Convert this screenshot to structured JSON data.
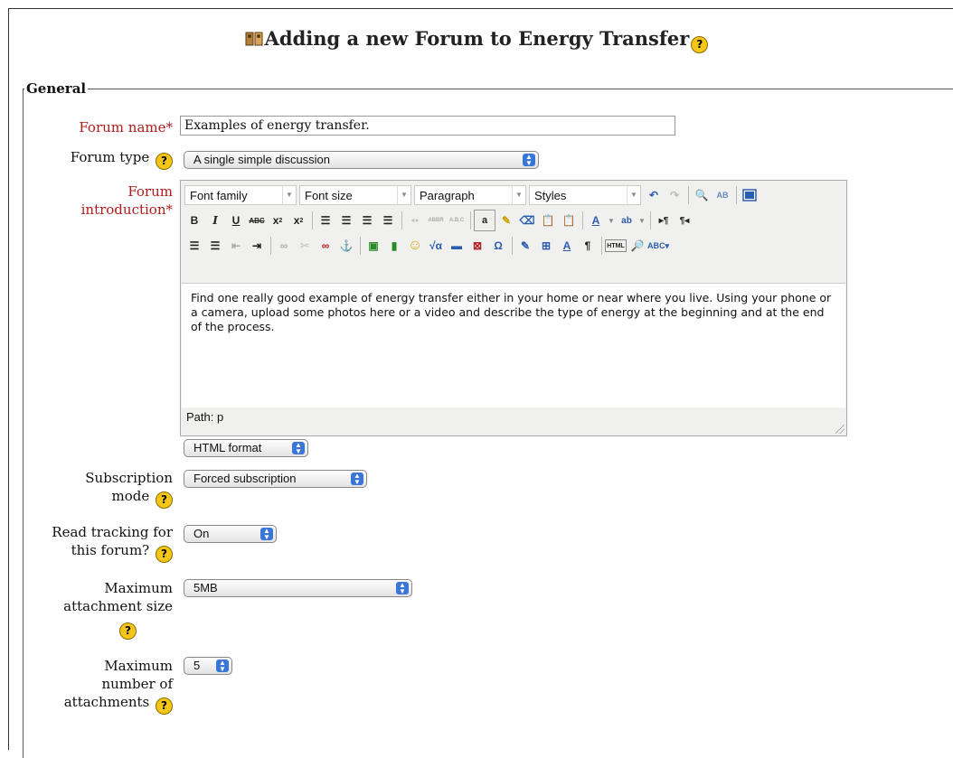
{
  "page": {
    "title": "Adding a new Forum to Energy Transfer"
  },
  "section": {
    "legend": "General"
  },
  "fields": {
    "forum_name": {
      "label": "Forum name",
      "required_mark": "*",
      "value": "Examples of energy transfer."
    },
    "forum_type": {
      "label": "Forum type",
      "value": "A single simple discussion"
    },
    "forum_intro": {
      "label_line1": "Forum",
      "label_line2": "introduction",
      "required_mark": "*",
      "toolbar": {
        "font_family": "Font family",
        "font_size": "Font size",
        "format": "Paragraph",
        "styles": "Styles"
      },
      "content": "Find one really good example of energy transfer either in your home or near where you live. Using your phone or a camera, upload some photos here or a video and describe the type of energy at the beginning and at the end of the process.",
      "path": "Path: p",
      "format_select": "HTML format"
    },
    "subscription_mode": {
      "label_line1": "Subscription",
      "label_line2": "mode",
      "value": "Forced subscription"
    },
    "read_tracking": {
      "label_line1": "Read tracking for",
      "label_line2": "this forum?",
      "value": "On"
    },
    "max_attachment_size": {
      "label_line1": "Maximum",
      "label_line2": "attachment size",
      "value": "5MB"
    },
    "max_attachments": {
      "label_line1": "Maximum",
      "label_line2": "number of",
      "label_line3": "attachments",
      "value": "5"
    }
  },
  "help_icon_glyph": "?",
  "colors": {
    "required": "#b01c1c",
    "help": "#f5c518",
    "select_arrow": "#3a76d8"
  }
}
